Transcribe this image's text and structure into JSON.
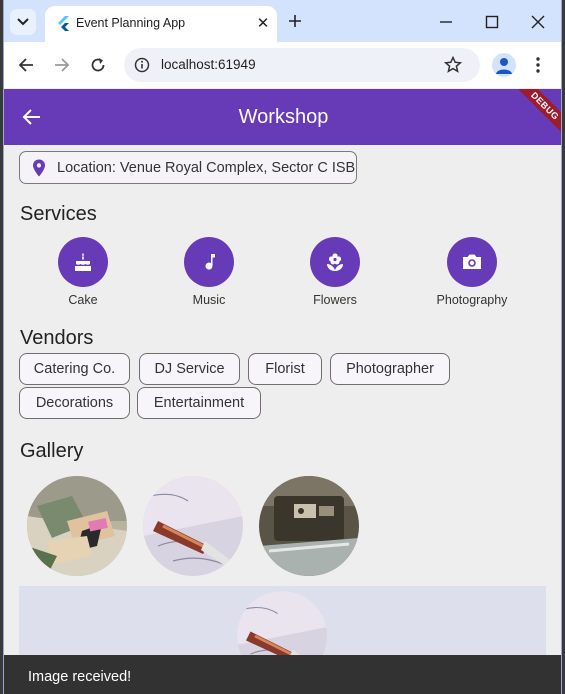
{
  "browser": {
    "tab_title": "Event Planning App",
    "url": "localhost:61949"
  },
  "appbar": {
    "title": "Workshop",
    "debug_banner": "DEBUG",
    "color": "#673ab7"
  },
  "location": {
    "text": "Location: Venue Royal Complex, Sector C ISB"
  },
  "services": {
    "heading": "Services",
    "items": [
      {
        "label": "Cake",
        "icon": "cake-icon"
      },
      {
        "label": "Music",
        "icon": "music-note-icon"
      },
      {
        "label": "Flowers",
        "icon": "flower-icon"
      },
      {
        "label": "Photography",
        "icon": "camera-icon"
      }
    ]
  },
  "vendors": {
    "heading": "Vendors",
    "chips": [
      "Catering Co.",
      "DJ Service",
      "Florist",
      "Photographer",
      "Decorations",
      "Entertainment"
    ]
  },
  "gallery": {
    "heading": "Gallery"
  },
  "snackbar": {
    "message": "Image received!"
  }
}
